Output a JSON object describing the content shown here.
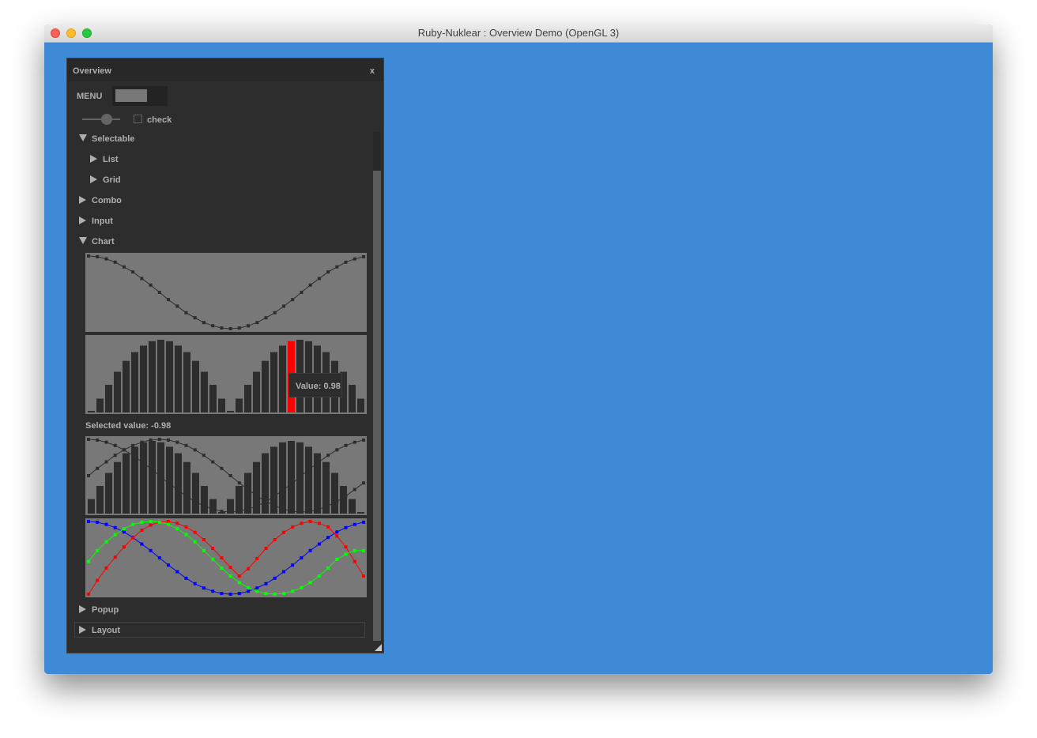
{
  "window": {
    "title": "Ruby-Nuklear : Overview Demo (OpenGL 3)"
  },
  "panel": {
    "title": "Overview",
    "close_label": "x",
    "menu_label": "MENU",
    "menu_progress": 0.6,
    "slider_value": 0.6,
    "checkbox_label": "check",
    "checkbox_checked": false,
    "tree": [
      {
        "label": "Selectable",
        "expanded": true
      },
      {
        "label": "List",
        "expanded": false
      },
      {
        "label": "Grid",
        "expanded": false
      },
      {
        "label": "Combo",
        "expanded": false
      },
      {
        "label": "Input",
        "expanded": false
      },
      {
        "label": "Chart",
        "expanded": true
      },
      {
        "label": "Popup",
        "expanded": false
      },
      {
        "label": "Layout",
        "expanded": false
      }
    ],
    "selected_value_text": "Selected value: -0.98",
    "tooltip_text": "Value: 0.98"
  },
  "colors": {
    "desktop": "#3f8ad6",
    "panel": "#2d2d2d",
    "chart_bg": "#787878",
    "chart_mark": "#2d2d2d",
    "highlight": "#ff0000",
    "series_blue": "#0000ff",
    "series_red": "#ff0000",
    "series_green": "#00ff00"
  },
  "chart_data": [
    {
      "type": "line",
      "x": [
        0,
        1,
        2,
        3,
        4,
        5,
        6,
        7,
        8,
        9,
        10,
        11,
        12,
        13,
        14,
        15,
        16,
        17,
        18,
        19,
        20,
        21,
        22,
        23,
        24,
        25,
        26,
        27,
        28,
        29,
        30,
        31
      ],
      "series": [
        {
          "values": [
            1.0,
            0.98,
            0.92,
            0.83,
            0.7,
            0.56,
            0.38,
            0.2,
            0.0,
            -0.2,
            -0.38,
            -0.56,
            -0.7,
            -0.83,
            -0.92,
            -0.98,
            -1.0,
            -0.98,
            -0.92,
            -0.83,
            -0.7,
            -0.56,
            -0.38,
            -0.2,
            0.0,
            0.2,
            0.38,
            0.56,
            0.7,
            0.83,
            0.92,
            0.98
          ]
        }
      ],
      "ylim": [
        -1,
        1
      ]
    },
    {
      "type": "bar",
      "x": [
        0,
        1,
        2,
        3,
        4,
        5,
        6,
        7,
        8,
        9,
        10,
        11,
        12,
        13,
        14,
        15,
        16,
        17,
        18,
        19,
        20,
        21,
        22,
        23,
        24,
        25,
        26,
        27,
        28,
        29,
        30,
        31
      ],
      "series": [
        {
          "values": [
            0.0,
            0.19,
            0.38,
            0.56,
            0.71,
            0.83,
            0.92,
            0.98,
            1.0,
            0.98,
            0.92,
            0.83,
            0.71,
            0.56,
            0.38,
            0.19,
            0.0,
            -0.19,
            -0.38,
            -0.56,
            -0.71,
            -0.83,
            -0.92,
            -0.98,
            -1.0,
            -0.98,
            -0.92,
            -0.83,
            -0.71,
            -0.56,
            -0.38,
            -0.19
          ]
        }
      ],
      "highlight_index": 23,
      "ylim": [
        0,
        1
      ]
    },
    {
      "type": "bar",
      "x": [
        0,
        1,
        2,
        3,
        4,
        5,
        6,
        7,
        8,
        9,
        10,
        11,
        12,
        13,
        14,
        15,
        16,
        17,
        18,
        19,
        20,
        21,
        22,
        23,
        24,
        25,
        26,
        27,
        28,
        29,
        30,
        31
      ],
      "series": [
        {
          "values": [
            0.2,
            0.38,
            0.56,
            0.71,
            0.83,
            0.92,
            0.98,
            1.0,
            0.98,
            0.92,
            0.83,
            0.71,
            0.56,
            0.38,
            0.2,
            0.0,
            0.2,
            0.38,
            0.56,
            0.71,
            0.83,
            0.92,
            0.98,
            1.0,
            0.98,
            0.92,
            0.83,
            0.71,
            0.56,
            0.38,
            0.2,
            0.0
          ]
        },
        {
          "values": [
            0.0,
            0.2,
            0.38,
            0.56,
            0.71,
            0.83,
            0.92,
            0.98,
            1.0,
            0.98,
            0.92,
            0.83,
            0.71,
            0.56,
            0.38,
            0.2,
            0.0,
            -0.2,
            -0.38,
            -0.56,
            -0.71,
            -0.83,
            -0.92,
            -0.98,
            -1.0,
            -0.98,
            -0.92,
            -0.83,
            -0.71,
            -0.56,
            -0.38,
            -0.2
          ]
        },
        {
          "values": [
            1.0,
            0.98,
            0.92,
            0.83,
            0.71,
            0.56,
            0.38,
            0.2,
            0.0,
            -0.2,
            -0.38,
            -0.56,
            -0.71,
            -0.83,
            -0.92,
            -0.98,
            -1.0,
            -0.98,
            -0.92,
            -0.83,
            -0.71,
            -0.56,
            -0.38,
            -0.2,
            0.0,
            0.2,
            0.38,
            0.56,
            0.71,
            0.83,
            0.92,
            0.98
          ]
        }
      ],
      "ylim": [
        -1,
        1
      ]
    },
    {
      "type": "line",
      "x": [
        0,
        1,
        2,
        3,
        4,
        5,
        6,
        7,
        8,
        9,
        10,
        11,
        12,
        13,
        14,
        15,
        16,
        17,
        18,
        19,
        20,
        21,
        22,
        23,
        24,
        25,
        26,
        27,
        28,
        29,
        30,
        31
      ],
      "series": [
        {
          "values": [
            1.0,
            0.98,
            0.92,
            0.83,
            0.71,
            0.56,
            0.38,
            0.2,
            0.0,
            -0.2,
            -0.38,
            -0.56,
            -0.71,
            -0.83,
            -0.92,
            -0.98,
            -1.0,
            -0.98,
            -0.92,
            -0.83,
            -0.71,
            -0.56,
            -0.38,
            -0.2,
            0.0,
            0.2,
            0.38,
            0.56,
            0.71,
            0.83,
            0.92,
            0.98
          ]
        },
        {
          "values": [
            -1.0,
            -0.62,
            -0.28,
            0.02,
            0.3,
            0.55,
            0.76,
            0.9,
            0.98,
            1.0,
            0.95,
            0.85,
            0.7,
            0.5,
            0.26,
            0.0,
            -0.26,
            -0.5,
            -0.3,
            -0.02,
            0.26,
            0.5,
            0.7,
            0.85,
            0.95,
            1.0,
            0.95,
            0.85,
            0.6,
            0.3,
            -0.1,
            -0.5
          ]
        },
        {
          "values": [
            -0.1,
            0.2,
            0.44,
            0.64,
            0.8,
            0.92,
            0.98,
            1.0,
            0.98,
            0.92,
            0.8,
            0.64,
            0.44,
            0.2,
            -0.04,
            -0.28,
            -0.5,
            -0.68,
            -0.82,
            -0.92,
            -0.98,
            -1.0,
            -0.98,
            -0.92,
            -0.82,
            -0.68,
            -0.5,
            -0.28,
            -0.04,
            0.1,
            0.2,
            0.2
          ]
        }
      ],
      "ylim": [
        -1,
        1
      ]
    }
  ]
}
